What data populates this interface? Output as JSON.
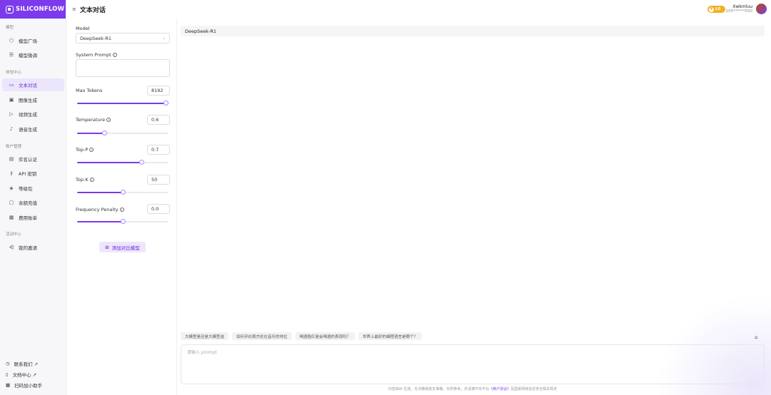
{
  "app": {
    "logo": "SILICONFLOW",
    "page_title": "文本对话"
  },
  "sidebar": {
    "sections": [
      {
        "title": "模型",
        "items": [
          {
            "label": "模型广场",
            "icon": "cube-icon"
          },
          {
            "label": "模型微调",
            "icon": "sliders-icon"
          }
        ]
      },
      {
        "title": "体验中心",
        "items": [
          {
            "label": "文本对话",
            "icon": "monitor-icon"
          },
          {
            "label": "图像生成",
            "icon": "image-icon"
          },
          {
            "label": "视频生成",
            "icon": "video-icon"
          },
          {
            "label": "语音生成",
            "icon": "mic-icon"
          }
        ]
      },
      {
        "title": "账户管理",
        "items": [
          {
            "label": "实名认证",
            "icon": "id-card-icon"
          },
          {
            "label": "API 密钥",
            "icon": "key-icon"
          },
          {
            "label": "等级包",
            "icon": "package-icon"
          },
          {
            "label": "余额充值",
            "icon": "wallet-icon"
          },
          {
            "label": "费用账单",
            "icon": "bill-icon"
          }
        ]
      },
      {
        "title": "活动中心",
        "items": [
          {
            "label": "我的邀请",
            "icon": "share-icon"
          }
        ]
      }
    ],
    "footer": [
      {
        "label": "联系我们 ↗",
        "icon": "contact-icon"
      },
      {
        "label": "文档中心 ↗",
        "icon": "doc-icon"
      },
      {
        "label": "扫码加小助手",
        "icon": "qr-icon"
      }
    ]
  },
  "header": {
    "badge": "L0",
    "user_name": "Xwkmluu",
    "user_phone": "155******550"
  },
  "params": {
    "model_label": "Model",
    "model_value": "DeepSeek-R1",
    "system_prompt_label": "System Prompt",
    "max_tokens": {
      "label": "Max Tokens",
      "value": "8192",
      "level": 1.0
    },
    "temperature": {
      "label": "Temperature",
      "value": "0.6",
      "level": 0.3
    },
    "top_p": {
      "label": "Top-P",
      "value": "0.7",
      "level": 0.7
    },
    "top_k": {
      "label": "Top-K",
      "value": "50",
      "level": 0.5
    },
    "frequency_penalty": {
      "label": "Frequency Penalty",
      "value": "0.0",
      "level": 0.5
    },
    "add_compare": "添加对比模型"
  },
  "chat": {
    "model_title": "DeepSeek-R1",
    "suggestions": [
      "大模型是还是大模型选",
      "如何评价周杰伦在音乐的地位",
      "喝酒脸红是会喝酒的表现吗？",
      "世界上最好的编程语言是哪个？"
    ],
    "input_placeholder": "请输入 prompt",
    "disclaimer_before": "内容由AI 生成，无法确保真实准确，仅供参考，并请遵守本平台",
    "disclaimer_link": "《用户协议》",
    "disclaimer_after": "及国家网络信息安全相关规定"
  },
  "colors": {
    "accent": "#7c3aed",
    "badge": "#f3b021"
  }
}
